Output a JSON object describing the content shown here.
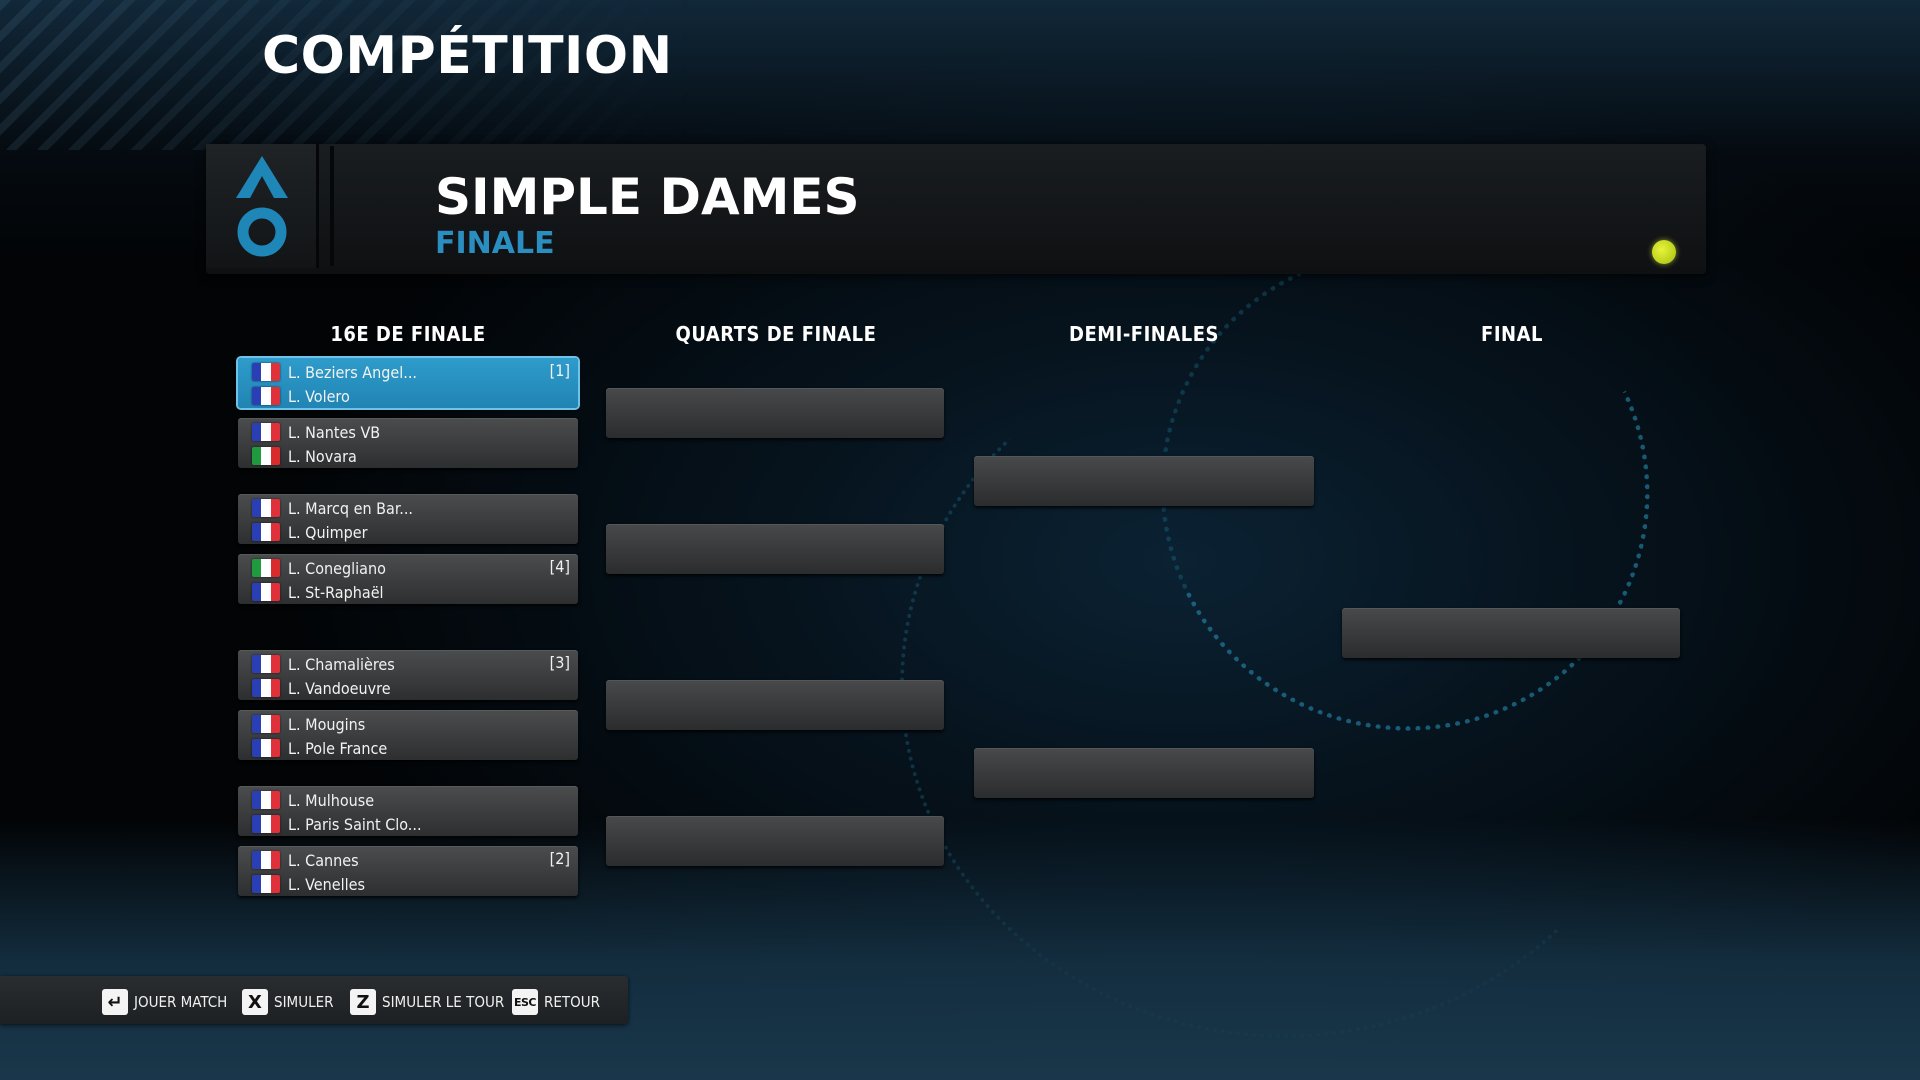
{
  "page": {
    "title": "COMPÉTITION"
  },
  "header": {
    "event": "SIMPLE DAMES",
    "round": "FINALE"
  },
  "columns": [
    "16E DE FINALE",
    "QUARTS DE FINALE",
    "DEMI-FINALES",
    "FINAL"
  ],
  "colors": {
    "accent": "#2a8fc0",
    "selected": "#2184b3",
    "ball": "#d4e62a"
  },
  "flags": {
    "france": [
      "#2a3fb3",
      "#ffffff",
      "#e0303a"
    ],
    "italy": [
      "#1f9a3e",
      "#ffffff",
      "#d92b2b"
    ]
  },
  "matches": [
    {
      "top": "L. Beziers Angel...",
      "top_flag": "france",
      "bottom": "L. Volero",
      "bottom_flag": "france",
      "seed": "[1]",
      "selected": true
    },
    {
      "top": "L. Nantes VB",
      "top_flag": "france",
      "bottom": "L. Novara",
      "bottom_flag": "italy",
      "seed": ""
    },
    {
      "top": "L. Marcq en Bar...",
      "top_flag": "france",
      "bottom": "L. Quimper",
      "bottom_flag": "france",
      "seed": ""
    },
    {
      "top": "L. Conegliano",
      "top_flag": "italy",
      "bottom": "L. St-Raphaël",
      "bottom_flag": "france",
      "seed": "[4]"
    },
    {
      "top": "L. Chamalières",
      "top_flag": "france",
      "bottom": "L. Vandoeuvre",
      "bottom_flag": "france",
      "seed": "[3]"
    },
    {
      "top": "L. Mougins",
      "top_flag": "france",
      "bottom": "L. Pole France",
      "bottom_flag": "france",
      "seed": ""
    },
    {
      "top": "L. Mulhouse",
      "top_flag": "france",
      "bottom": "L. Paris Saint Clo...",
      "bottom_flag": "france",
      "seed": ""
    },
    {
      "top": "L. Cannes",
      "top_flag": "france",
      "bottom": "L. Venelles",
      "bottom_flag": "france",
      "seed": "[2]"
    }
  ],
  "controls": [
    {
      "key": "↵",
      "label": "JOUER MATCH"
    },
    {
      "key": "X",
      "label": "SIMULER"
    },
    {
      "key": "Z",
      "label": "SIMULER LE TOUR"
    },
    {
      "key": "ESC",
      "label": "RETOUR"
    }
  ]
}
